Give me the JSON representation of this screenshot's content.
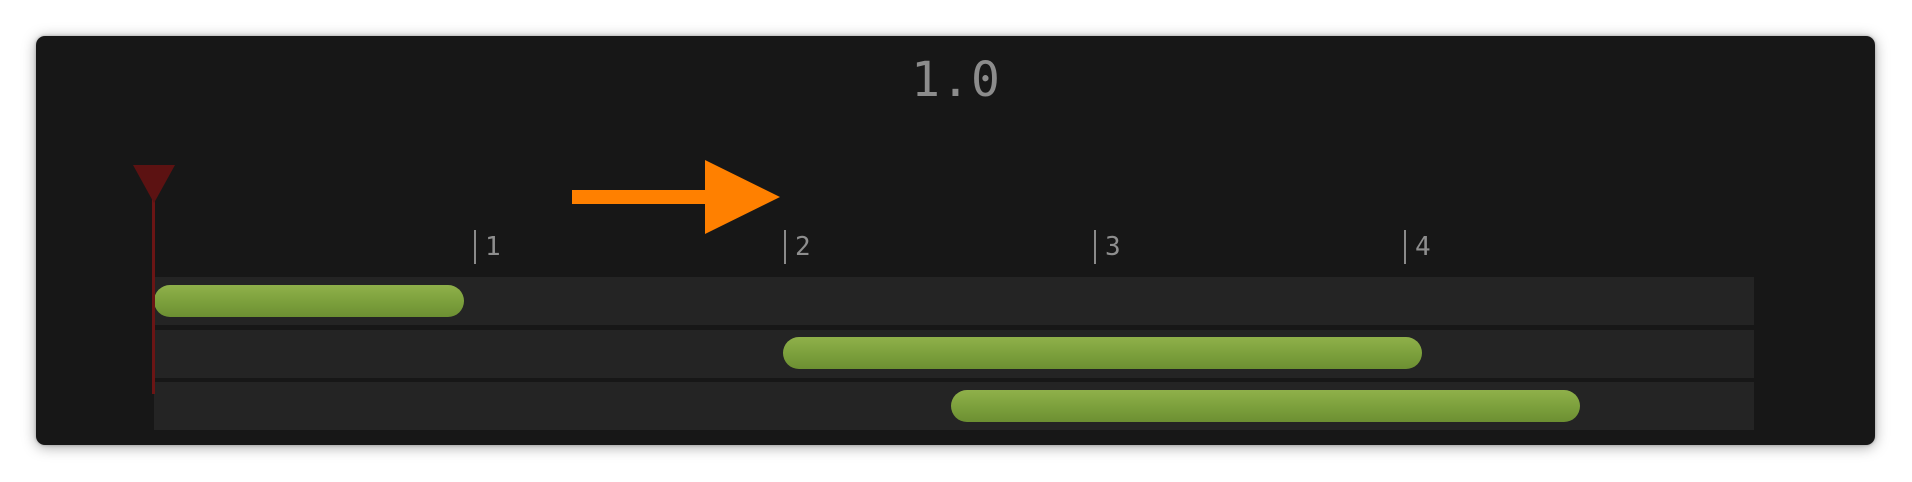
{
  "time_display": "1.0",
  "ruler": {
    "ticks": [
      {
        "label": "1"
      },
      {
        "label": "2"
      },
      {
        "label": "3"
      },
      {
        "label": "4"
      }
    ]
  },
  "tracks": [
    {
      "clip": {
        "start": 0.0,
        "end": 1.0
      }
    },
    {
      "clip": {
        "start": 2.03,
        "end": 4.09
      }
    },
    {
      "clip": {
        "start": 2.57,
        "end": 4.6
      }
    }
  ],
  "playhead": {
    "position": 0.0
  },
  "icons": {
    "direction": "right-arrow-icon",
    "playhead": "playhead-marker-icon"
  },
  "colors": {
    "background": "#171717",
    "track": "#242424",
    "clip": "#7da13d",
    "arrow": "#ff8000",
    "playhead": "#6b1515",
    "text": "#8c8c8c"
  }
}
